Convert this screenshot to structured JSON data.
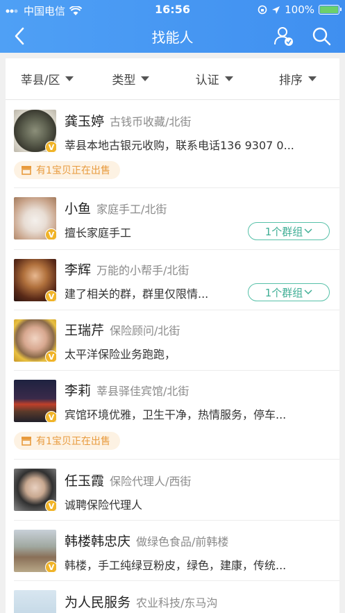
{
  "status": {
    "carrier": "中国电信",
    "time": "16:56",
    "battery": "100%"
  },
  "nav": {
    "title": "找能人"
  },
  "filters": [
    {
      "label": "莘县/区"
    },
    {
      "label": "类型"
    },
    {
      "label": "认证"
    },
    {
      "label": "排序"
    }
  ],
  "colors": {
    "accent": "#4a9af3",
    "group": "#3fae95",
    "sale": "#e89a3c",
    "vbadge": "#f0b429"
  },
  "people": [
    {
      "name": "龚玉婷",
      "sub": "古钱币收藏/北街",
      "desc": "莘县本地古银元收购，联系电话136 9307 0...",
      "sale": "有1宝贝正在出售"
    },
    {
      "name": "小鱼",
      "sub": "家庭手工/北街",
      "desc": "擅长家庭手工",
      "group": "1个群组"
    },
    {
      "name": "李辉",
      "sub": "万能的小帮手/北街",
      "desc": "建了相关的群，群里仅限情...",
      "group": "1个群组"
    },
    {
      "name": "王瑞芹",
      "sub": "保险顾问/北街",
      "desc": "太平洋保险业务跑跑，"
    },
    {
      "name": "李莉",
      "sub": "莘县驿佳宾馆/北街",
      "desc": "宾馆环境优雅，卫生干净，热情服务，停车...",
      "sale": "有1宝贝正在出售"
    },
    {
      "name": "任玉霞",
      "sub": "保险代理人/西街",
      "desc": "诚聘保险代理人"
    },
    {
      "name": "韩楼韩忠庆",
      "sub": "做绿色食品/前韩楼",
      "desc": "韩楼，手工纯绿豆粉皮，绿色，建康，传统..."
    },
    {
      "name": "为人民服务",
      "sub": "农业科技/东马沟",
      "desc": ""
    }
  ]
}
